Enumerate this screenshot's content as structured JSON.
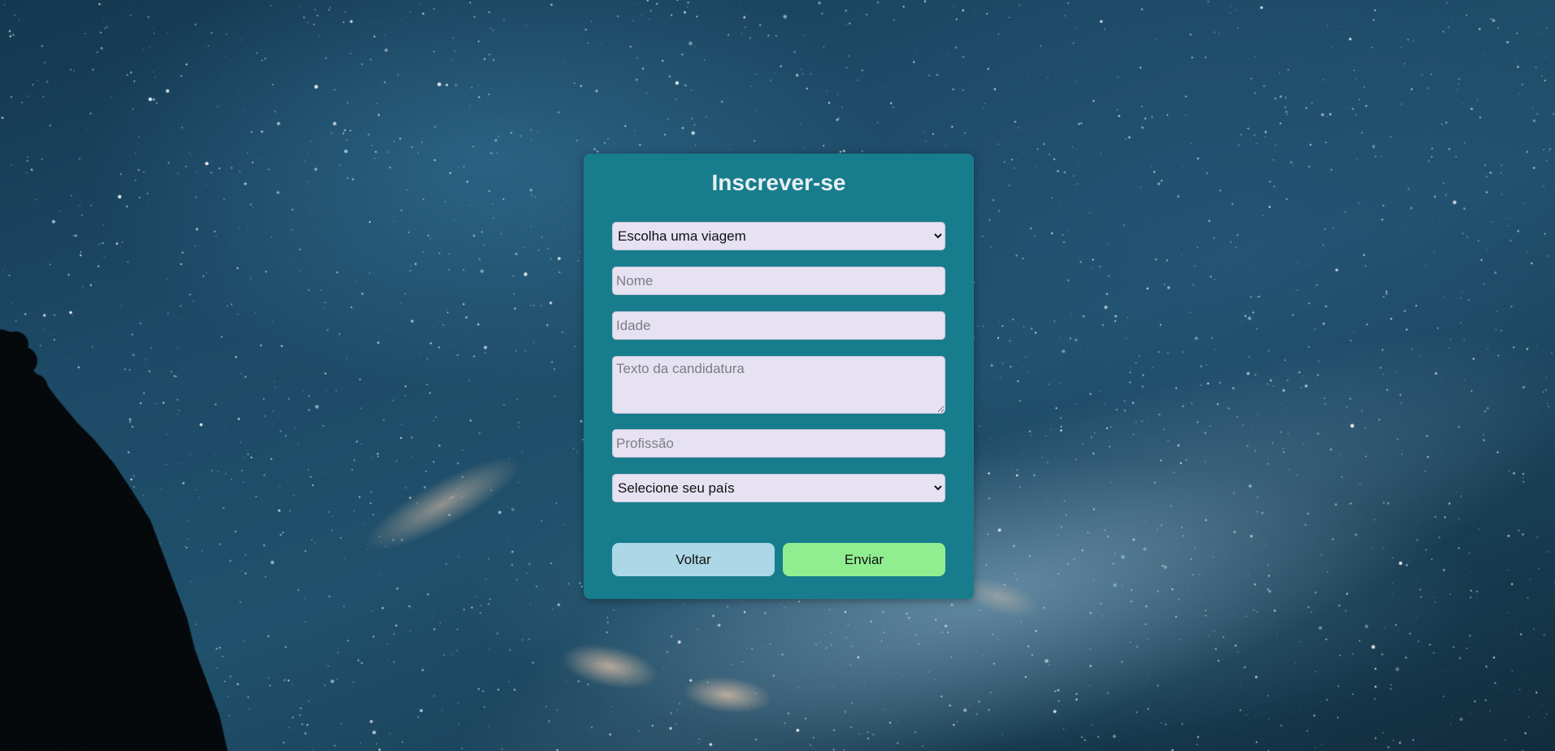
{
  "colors": {
    "card_background": "#177d8c",
    "title_color": "#e8eff3",
    "field_background": "#e6e2f2",
    "back_button": "#acd7e6",
    "send_button": "#90ee90"
  },
  "form": {
    "title": "Inscrever-se",
    "trip_select": {
      "selected": "Escolha uma viagem",
      "options": [
        "Escolha uma viagem"
      ]
    },
    "name_placeholder": "Nome",
    "age_placeholder": "Idade",
    "application_text_placeholder": "Texto da candidatura",
    "profession_placeholder": "Profissão",
    "country_select": {
      "selected": "Selecione seu país",
      "options": [
        "Selecione seu país"
      ]
    },
    "back_label": "Voltar",
    "send_label": "Enviar"
  }
}
